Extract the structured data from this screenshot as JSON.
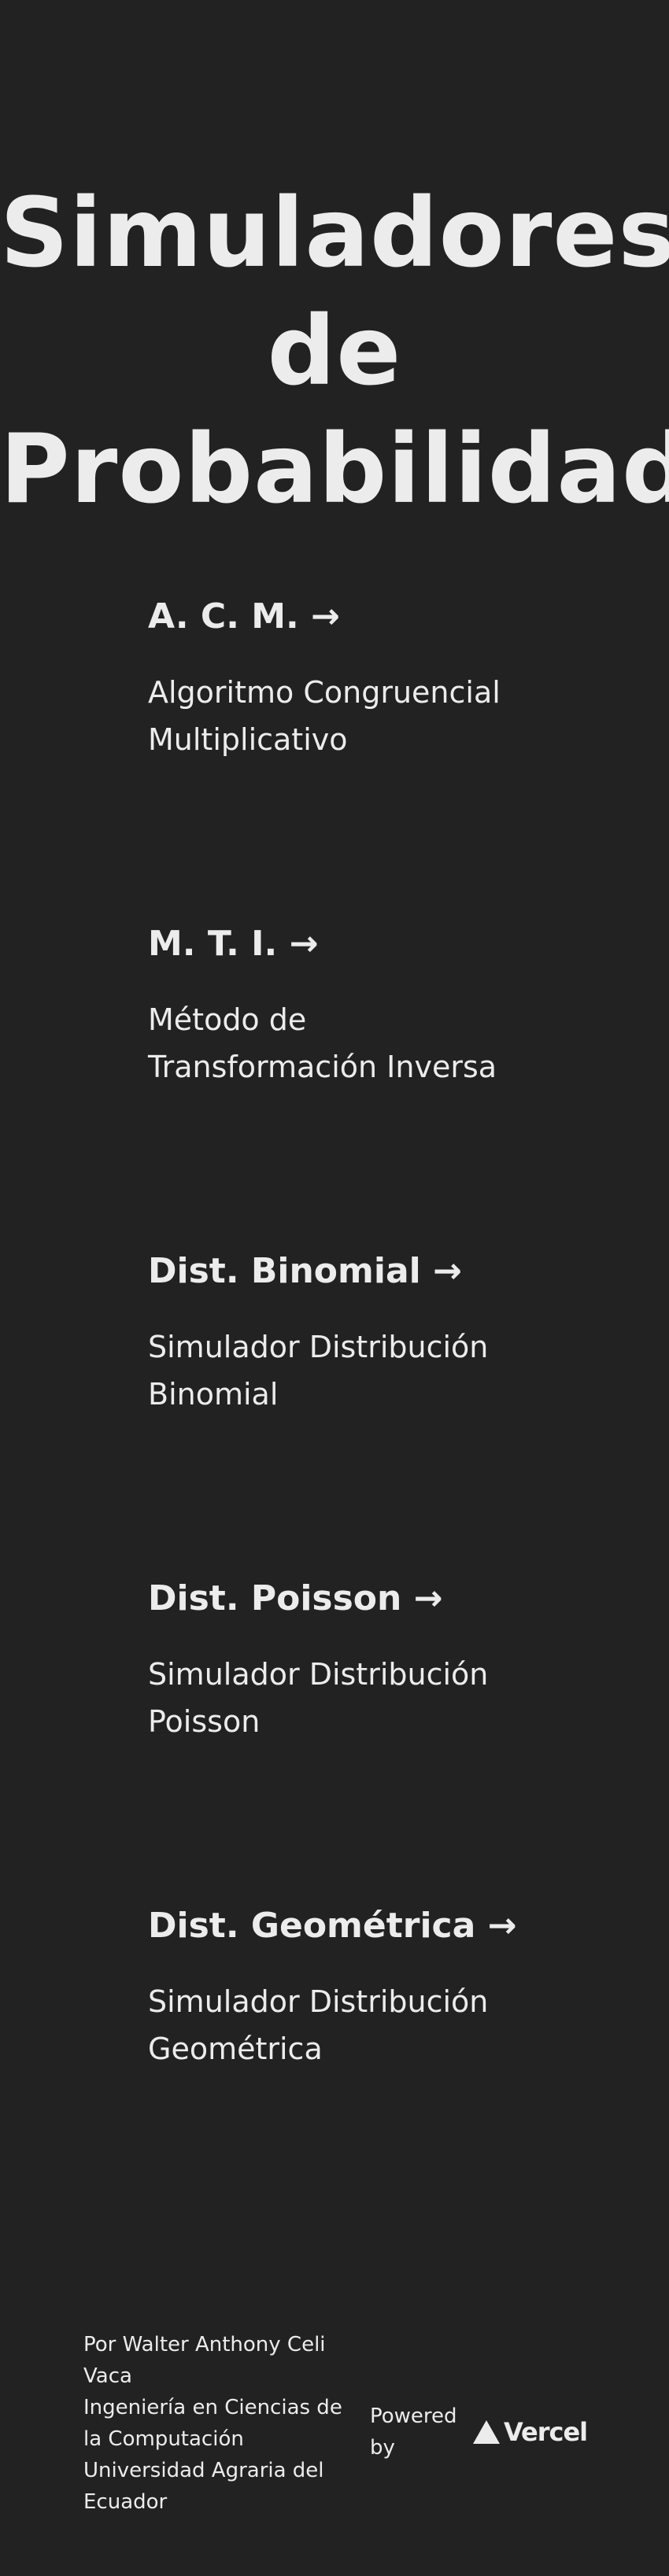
{
  "title": {
    "line1": "Simuladores",
    "line2": "de",
    "line3": "Probabilidad"
  },
  "cards": [
    {
      "heading": "A. C. M. →",
      "description": "Algoritmo Congruencial Multiplicativo"
    },
    {
      "heading": "M. T. I. →",
      "description": "Método de Transformación Inversa"
    },
    {
      "heading": "Dist. Binomial →",
      "description": "Simulador Distribución Binomial"
    },
    {
      "heading": "Dist. Poisson →",
      "description": "Simulador Distribución Poisson"
    },
    {
      "heading": "Dist. Geométrica →",
      "description": "Simulador Distribución Geométrica"
    }
  ],
  "footer": {
    "author": "Por Walter Anthony Celi Vaca",
    "career": "Ingeniería en Ciencias de la Computación",
    "university": "Universidad Agraria del Ecuador",
    "powered_by": "Powered by",
    "vercel_label": "Vercel",
    "vercel_icon": "vercel-triangle-icon"
  },
  "colors": {
    "background": "#222222",
    "text": "#ececec"
  }
}
